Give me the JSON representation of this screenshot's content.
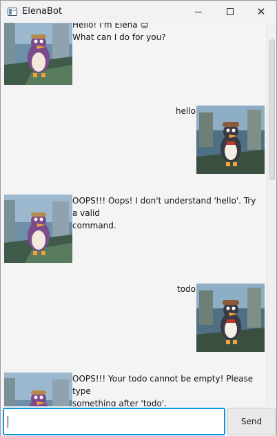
{
  "window": {
    "title": "ElenaBot",
    "minimize_icon": "minimize-icon",
    "maximize_icon": "maximize-icon",
    "close_icon": "close-icon",
    "close_glyph": "✕"
  },
  "messages": [
    {
      "sender": "bot",
      "lines": [
        "Hello! I'm Elena 😊",
        "What can I do for you?"
      ]
    },
    {
      "sender": "user",
      "lines": [
        "hello"
      ]
    },
    {
      "sender": "bot",
      "lines": [
        "OOPS!!! Oops! I don't understand 'hello'. Try a valid",
        "command."
      ]
    },
    {
      "sender": "user",
      "lines": [
        "todo"
      ]
    },
    {
      "sender": "bot",
      "lines": [
        "OOPS!!! Your todo cannot be empty! Please type",
        "something after 'todo'."
      ]
    }
  ],
  "input": {
    "value": "",
    "placeholder": ""
  },
  "send_label": "Send",
  "colors": {
    "input_focus_border": "#0e97d8",
    "background": "#f4f4f4"
  }
}
